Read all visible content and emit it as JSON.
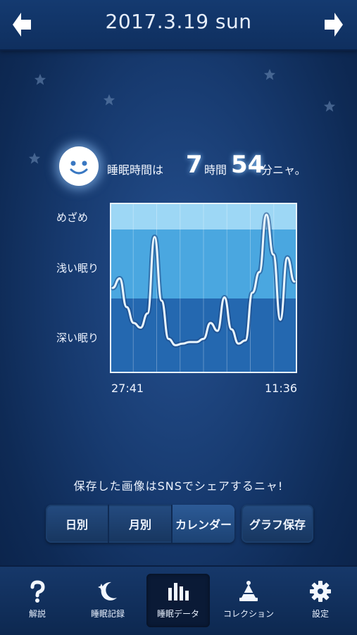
{
  "header": {
    "date_title": "2017.3.19 sun"
  },
  "summary": {
    "label": "睡眠時間は",
    "hours": "7",
    "hours_unit": "時間",
    "minutes": "54",
    "minutes_unit": "分ニャ。"
  },
  "chart_data": {
    "type": "line",
    "y_levels": [
      "めざめ",
      "浅い眠り",
      "深い眠り"
    ],
    "x_start": "27:41",
    "x_end": "11:36",
    "values": [
      0.5,
      0.56,
      0.38,
      0.28,
      0.25,
      0.34,
      0.82,
      0.42,
      0.18,
      0.14,
      0.15,
      0.16,
      0.16,
      0.18,
      0.28,
      0.23,
      0.44,
      0.24,
      0.15,
      0.17,
      0.47,
      0.6,
      0.96,
      0.71,
      0.3,
      0.69,
      0.54
    ],
    "grid": true,
    "colors": {
      "wake": "#9dd7f5",
      "light": "#4aa7e0",
      "deep": "#2468b0",
      "line": "#e9f6ff"
    }
  },
  "share_text": "保存した画像はSNSでシェアするニャ!",
  "segment": {
    "daily": "日別",
    "monthly": "月別",
    "calendar": "カレンダー"
  },
  "save_graph": "グラフ保存",
  "tabs": [
    {
      "label": "解説",
      "icon": "help-icon"
    },
    {
      "label": "睡眠記録",
      "icon": "moon-star-icon"
    },
    {
      "label": "睡眠データ",
      "icon": "bar-chart-icon"
    },
    {
      "label": "コレクション",
      "icon": "collection-icon"
    },
    {
      "label": "設定",
      "icon": "gear-icon"
    }
  ]
}
